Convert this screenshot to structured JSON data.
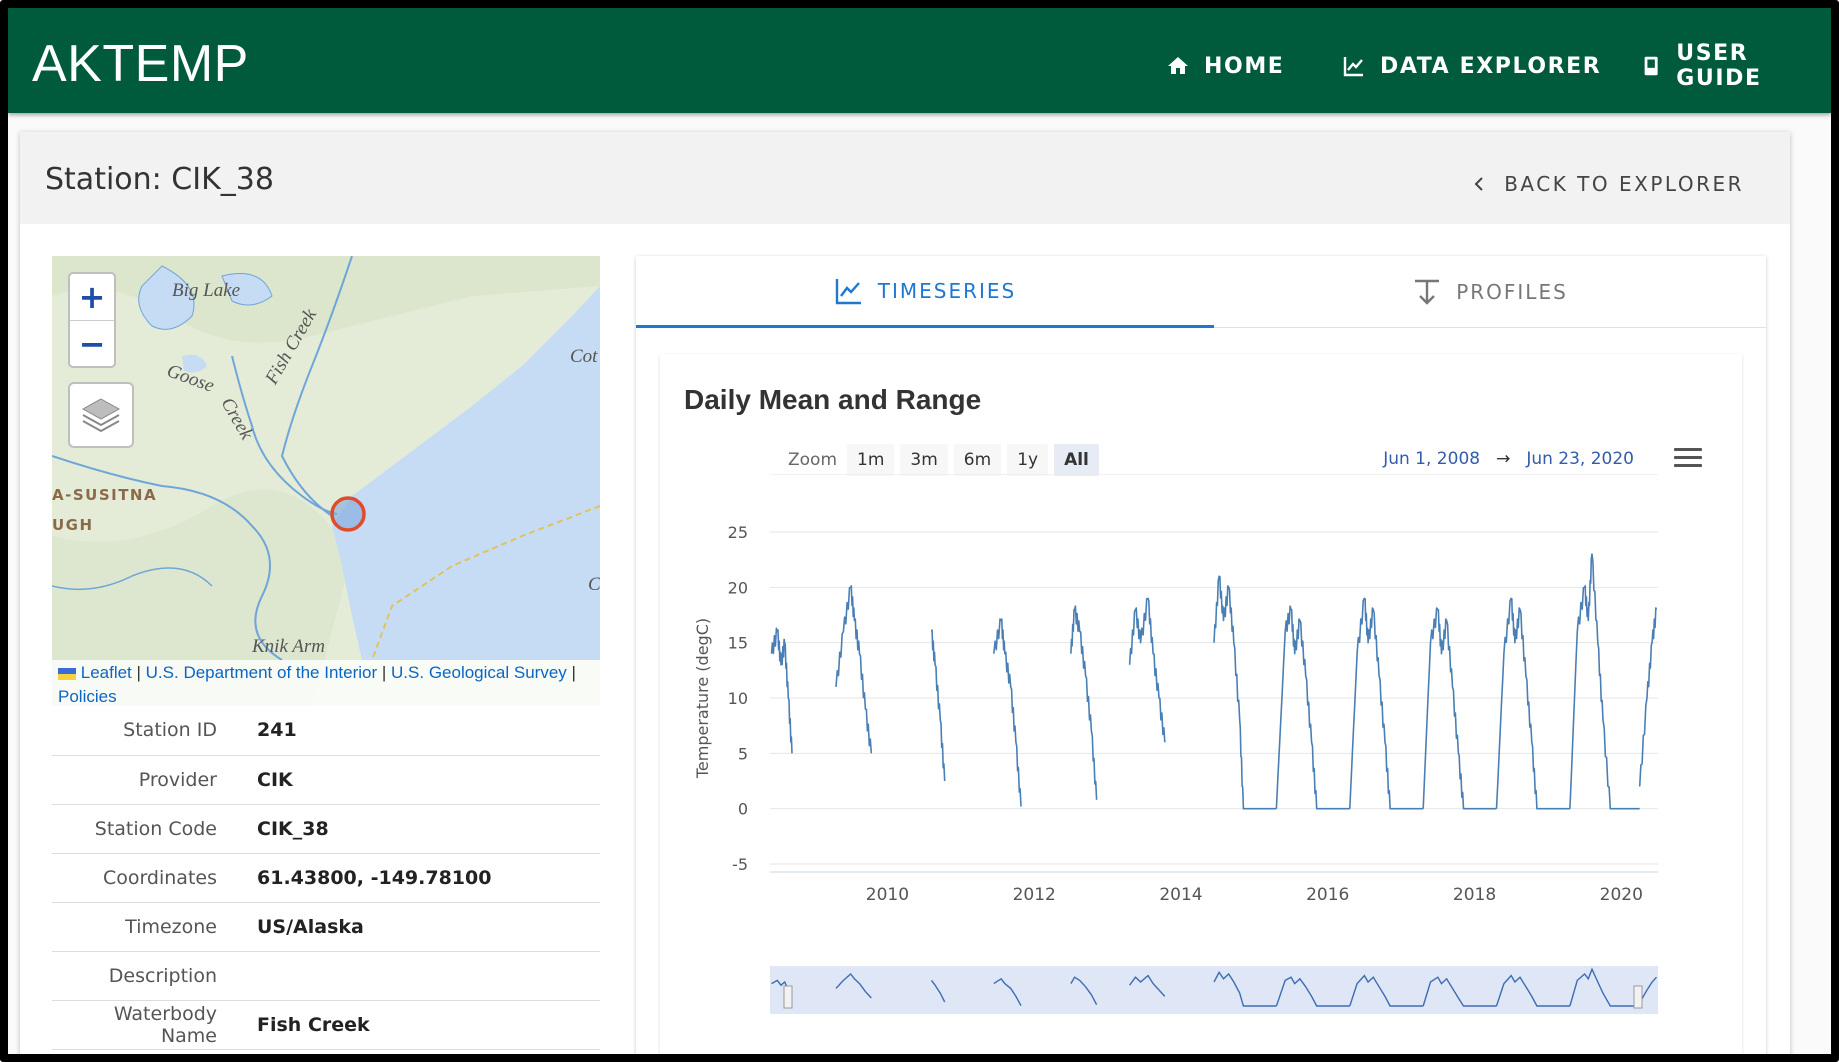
{
  "app": {
    "brand": "AKTEMP"
  },
  "nav": [
    {
      "label": "HOME",
      "icon": "home-icon"
    },
    {
      "label": "DATA EXPLORER",
      "icon": "chart-line-icon"
    },
    {
      "label": "USER GUIDE",
      "icon": "book-icon"
    }
  ],
  "page": {
    "title": "Station: CIK_38",
    "back_label": "BACK TO EXPLORER"
  },
  "map": {
    "zoom_in": "+",
    "zoom_out": "−",
    "labels": {
      "big_lake": "Big Lake",
      "fish_creek": "Fish Creek",
      "goose": "Goose",
      "creek": "Creek",
      "knik_arm": "Knik Arm",
      "susitna": "A-SUSITNA",
      "ugh": "UGH",
      "cot": "Cot",
      "c": "C"
    },
    "attribution": {
      "leaflet": "Leaflet",
      "sep1": " | ",
      "doi": "U.S. Department of the Interior",
      "sep2": " | ",
      "usgs": "U.S. Geological Survey",
      "sep3": " | ",
      "policies": "Policies"
    }
  },
  "station_info": [
    {
      "label": "Station ID",
      "value": "241"
    },
    {
      "label": "Provider",
      "value": "CIK"
    },
    {
      "label": "Station Code",
      "value": "CIK_38"
    },
    {
      "label": "Coordinates",
      "value": "61.43800, -149.78100"
    },
    {
      "label": "Timezone",
      "value": "US/Alaska"
    },
    {
      "label": "Description",
      "value": ""
    },
    {
      "label": "Waterbody Name",
      "value": "Fish Creek"
    }
  ],
  "tabs": [
    {
      "label": "TIMESERIES",
      "active": true
    },
    {
      "label": "PROFILES",
      "active": false
    }
  ],
  "chart": {
    "title": "Daily Mean and Range",
    "zoom_label": "Zoom",
    "zoom_buttons": [
      "1m",
      "3m",
      "6m",
      "1y",
      "All"
    ],
    "active_zoom": "All",
    "date_from": "Jun 1, 2008",
    "date_arrow": "→",
    "date_to": "Jun 23, 2020"
  },
  "colors": {
    "appbar": "#005b3c",
    "accent": "#1e78d2",
    "series": "#4a7fb5"
  },
  "chart_data": {
    "type": "line",
    "ylabel": "Temperature (degC)",
    "xlabel": "",
    "ylim": [
      -5,
      25
    ],
    "xlim": [
      2008.4,
      2020.5
    ],
    "y_ticks": [
      -5,
      0,
      5,
      10,
      15,
      20,
      25
    ],
    "x_ticks": [
      2010,
      2012,
      2014,
      2016,
      2018,
      2020
    ],
    "series": [
      {
        "segments": [
          {
            "x": [
              2008.42,
              2008.5,
              2008.55,
              2008.6,
              2008.65,
              2008.7
            ],
            "y": [
              14,
              16,
              13,
              15,
              10,
              5
            ]
          },
          {
            "x": [
              2009.3,
              2009.4,
              2009.5,
              2009.55,
              2009.62,
              2009.7,
              2009.78
            ],
            "y": [
              11,
              16,
              20,
              17,
              14,
              9,
              5
            ]
          },
          {
            "x": [
              2010.6,
              2010.65,
              2010.72,
              2010.78
            ],
            "y": [
              16,
              13,
              8,
              2.5
            ]
          },
          {
            "x": [
              2011.45,
              2011.55,
              2011.6,
              2011.68,
              2011.75,
              2011.82
            ],
            "y": [
              14,
              17,
              14,
              11,
              6,
              0.2
            ]
          },
          {
            "x": [
              2012.5,
              2012.55,
              2012.62,
              2012.7,
              2012.78,
              2012.85
            ],
            "y": [
              14,
              18,
              16,
              12,
              7,
              0.8
            ]
          },
          {
            "x": [
              2013.3,
              2013.38,
              2013.45,
              2013.55,
              2013.62,
              2013.7,
              2013.78
            ],
            "y": [
              13,
              18,
              15,
              19,
              14,
              10,
              6
            ]
          },
          {
            "x": [
              2014.45,
              2014.52,
              2014.58,
              2014.65,
              2014.72,
              2014.8,
              2014.85,
              2015.3
            ],
            "y": [
              15,
              21,
              17,
              20,
              15,
              8,
              0,
              0
            ]
          },
          {
            "x": [
              2015.3,
              2015.42,
              2015.5,
              2015.55,
              2015.62,
              2015.7,
              2015.78,
              2015.85,
              2016.3
            ],
            "y": [
              0,
              16,
              18,
              14,
              17,
              12,
              6,
              0,
              0
            ]
          },
          {
            "x": [
              2016.3,
              2016.4,
              2016.5,
              2016.55,
              2016.62,
              2016.7,
              2016.78,
              2016.85,
              2017.3
            ],
            "y": [
              0,
              14,
              19,
              15,
              18,
              12,
              6,
              0,
              0
            ]
          },
          {
            "x": [
              2017.3,
              2017.4,
              2017.5,
              2017.55,
              2017.62,
              2017.7,
              2017.78,
              2017.85,
              2018.3
            ],
            "y": [
              0,
              15,
              18,
              14,
              17,
              11,
              5,
              0,
              0
            ]
          },
          {
            "x": [
              2018.3,
              2018.4,
              2018.5,
              2018.55,
              2018.62,
              2018.7,
              2018.78,
              2018.85,
              2019.3
            ],
            "y": [
              0,
              14,
              19,
              15,
              18,
              12,
              6,
              0,
              0
            ]
          },
          {
            "x": [
              2019.3,
              2019.4,
              2019.5,
              2019.55,
              2019.6,
              2019.68,
              2019.75,
              2019.85,
              2020.25
            ],
            "y": [
              0,
              16,
              20,
              17,
              23,
              15,
              8,
              0,
              0
            ]
          },
          {
            "x": [
              2020.25,
              2020.35,
              2020.42,
              2020.48
            ],
            "y": [
              2,
              10,
              15,
              18
            ]
          }
        ]
      }
    ]
  }
}
